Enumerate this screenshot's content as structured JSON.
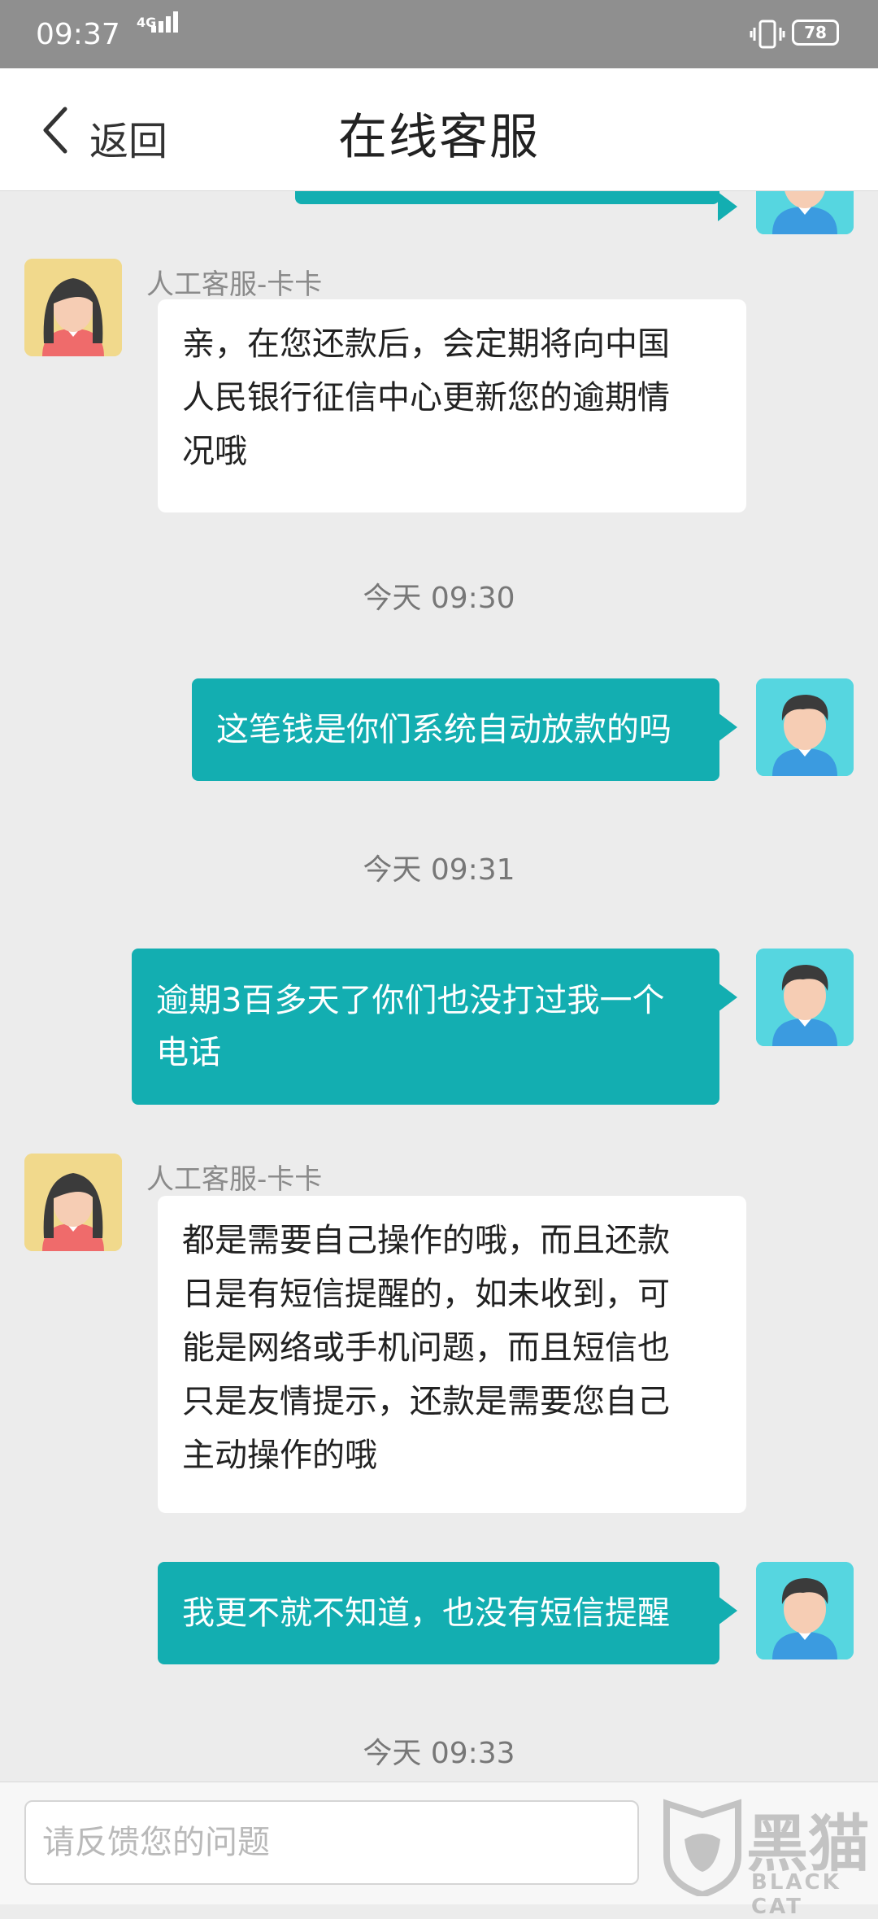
{
  "status_bar": {
    "time": "09:37",
    "network": "4G",
    "battery": "78"
  },
  "header": {
    "back_label": "返回",
    "title": "在线客服"
  },
  "messages": [
    {
      "type": "outgoing",
      "text": ""
    },
    {
      "type": "incoming",
      "sender": "人工客服-卡卡",
      "lines": [
        "亲，在您还款后，会定期将向中国",
        "人民银行征信中心更新您的逾期情",
        "况哦"
      ]
    },
    {
      "type": "timestamp",
      "text": "今天 09:30"
    },
    {
      "type": "outgoing",
      "lines": [
        "这笔钱是你们系统自动放款的吗"
      ]
    },
    {
      "type": "timestamp",
      "text": "今天 09:31"
    },
    {
      "type": "outgoing",
      "lines": [
        "逾期3百多天了你们也没打过我一个",
        "电话"
      ]
    },
    {
      "type": "incoming",
      "sender": "人工客服-卡卡",
      "lines": [
        "都是需要自己操作的哦，而且还款",
        "日是有短信提醒的，如未收到，可",
        "能是网络或手机问题，而且短信也",
        "只是友情提示，还款是需要您自己",
        "主动操作的哦"
      ]
    },
    {
      "type": "outgoing",
      "lines": [
        "我更不就不知道，也没有短信提醒"
      ]
    },
    {
      "type": "timestamp",
      "text": "今天 09:33"
    }
  ],
  "input": {
    "placeholder": "请反馈您的问题"
  },
  "watermark": {
    "text": "黑猫",
    "sub": "BLACK CAT"
  },
  "colors": {
    "accent": "#13aeb1",
    "status_bar": "#8f8f8f",
    "background": "#ececec"
  }
}
